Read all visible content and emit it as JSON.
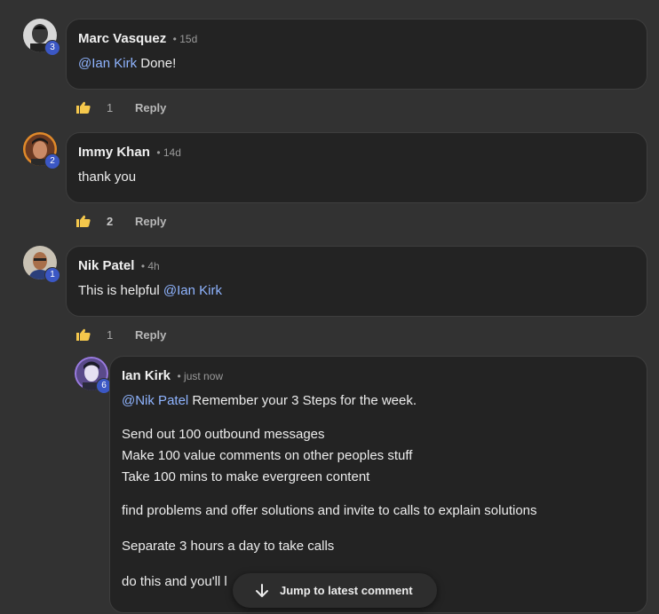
{
  "comments": [
    {
      "author": "Marc Vasquez",
      "time": "15d",
      "level": "3",
      "mention": "@Ian Kirk",
      "text": " Done!",
      "likes": "1",
      "reply_label": "Reply"
    },
    {
      "author": "Immy Khan",
      "time": "14d",
      "level": "2",
      "text": "thank you",
      "likes": "2",
      "reply_label": "Reply"
    },
    {
      "author": "Nik Patel",
      "time": "4h",
      "level": "1",
      "text": "This is helpful ",
      "mention": "@Ian Kirk",
      "likes": "1",
      "reply_label": "Reply"
    }
  ],
  "reply": {
    "author": "Ian Kirk",
    "time": "just now",
    "level": "6",
    "mention": "@Nik Patel",
    "line1": " Remember your 3 Steps for the week.",
    "steps": [
      "Send out 100 outbound messages",
      "Make 100 value comments on other peoples stuff",
      "Take 100 mins to make evergreen content"
    ],
    "para2": "find problems and offer solutions and invite to calls to explain solutions",
    "para3": "Separate 3 hours a day to take calls",
    "para4": "do this and you'll l"
  },
  "jump_button": {
    "label": "Jump to latest comment"
  },
  "colors": {
    "background": "#323232",
    "bubble": "#232323",
    "mention": "#8fb4ff",
    "level_badge": "#3b57c4",
    "like_icon": "#f5c84c"
  }
}
